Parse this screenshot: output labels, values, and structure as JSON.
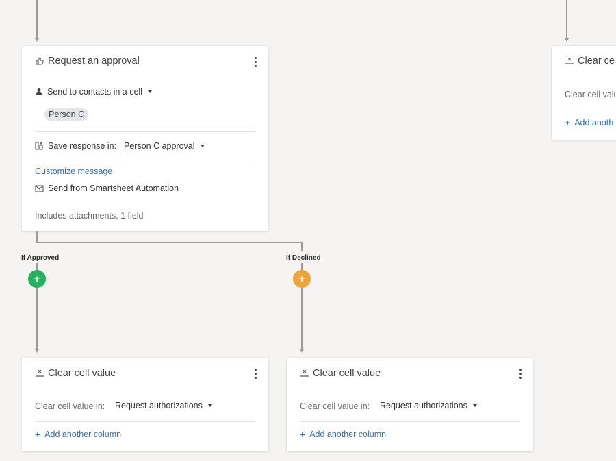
{
  "approval_card": {
    "title": "Request an approval",
    "send_to_label": "Send to contacts in a cell",
    "contact_chip": "Person C",
    "save_response_label": "Save response in:",
    "save_response_value": "Person C approval",
    "customize_link": "Customize message",
    "send_from_label": "Send from Smartsheet Automation",
    "includes_text": "Includes attachments, 1 field"
  },
  "branches": {
    "approved_label": "If Approved",
    "declined_label": "If Declined",
    "approved_color": "#23b35a",
    "declined_color": "#f0a431"
  },
  "clear_card_left": {
    "title": "Clear cell value",
    "field_label": "Clear cell value in:",
    "field_value": "Request authorizations",
    "add_link": "Add another column"
  },
  "clear_card_mid": {
    "title": "Clear cell value",
    "field_label": "Clear cell value in:",
    "field_value": "Request authorizations",
    "add_link": "Add another column"
  },
  "clear_card_right": {
    "title": "Clear ce",
    "field_label": "Clear cell valu",
    "add_link": "Add anoth"
  },
  "icons": {
    "approval": "thumbs-up-icon",
    "person": "person-icon",
    "save": "columns-icon",
    "mail": "envelope-icon",
    "clear": "clear-cell-icon",
    "plus": "plus-icon",
    "kebab": "more-vertical-icon"
  }
}
